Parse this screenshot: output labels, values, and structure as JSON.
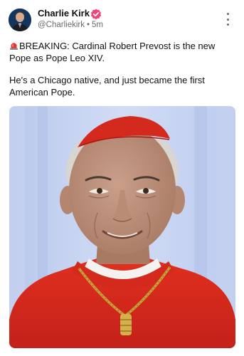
{
  "author": {
    "name": "Charlie Kirk",
    "handle": "@Charliekirk",
    "separator": "•",
    "time": "5m"
  },
  "post": {
    "paragraphs": [
      "BREAKING: Cardinal Robert Prevost is the new Pope as Pope Leo XIV.",
      "He's a Chicago native, and just became the first American Pope."
    ]
  },
  "icons": {
    "verified": "verified-badge-icon",
    "more": "more-vertical-icon",
    "siren": "siren-emoji-icon"
  },
  "colors": {
    "verified": "#f0457a",
    "siren": "#e0362d",
    "cassock_red": "#d8281e"
  }
}
